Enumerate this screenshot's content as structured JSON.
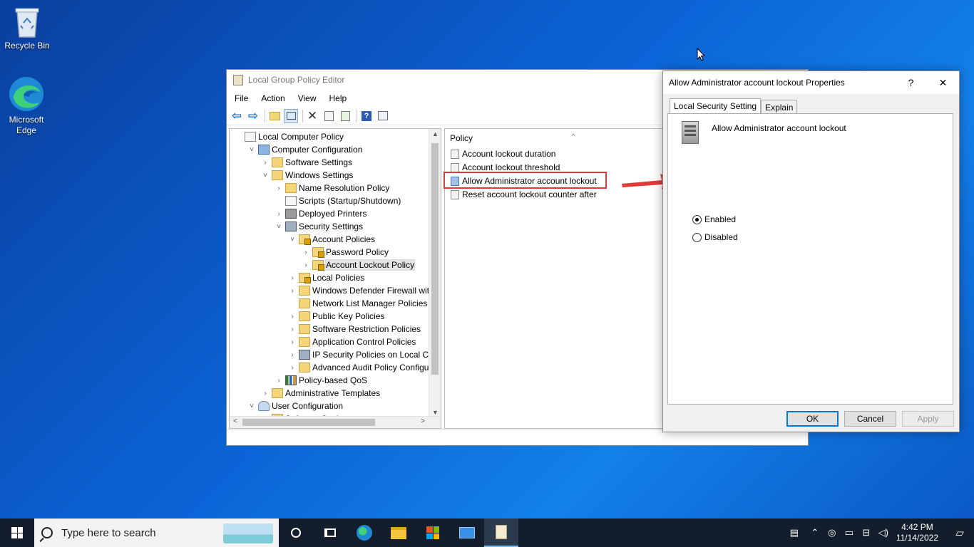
{
  "desktop": {
    "icons": [
      {
        "label": "Recycle Bin"
      },
      {
        "label": "Microsoft Edge"
      }
    ]
  },
  "gpo": {
    "title": "Local Group Policy Editor",
    "menu": [
      "File",
      "Action",
      "View",
      "Help"
    ],
    "tree": [
      {
        "label": "Local Computer Policy",
        "icon": "document-icon",
        "expander": ""
      },
      {
        "label": "Computer Configuration",
        "icon": "computer-icon",
        "expander": "˅"
      },
      {
        "label": "Software Settings",
        "icon": "folder-icon",
        "expander": "›"
      },
      {
        "label": "Windows Settings",
        "icon": "folder-icon",
        "expander": "˅"
      },
      {
        "label": "Name Resolution Policy",
        "icon": "folder-icon",
        "expander": "›"
      },
      {
        "label": "Scripts (Startup/Shutdown)",
        "icon": "script-icon",
        "expander": ""
      },
      {
        "label": "Deployed Printers",
        "icon": "printer-icon",
        "expander": "›"
      },
      {
        "label": "Security Settings",
        "icon": "security-icon",
        "expander": "˅"
      },
      {
        "label": "Account Policies",
        "icon": "folder-lock-icon",
        "expander": "˅"
      },
      {
        "label": "Password Policy",
        "icon": "folder-lock-icon",
        "expander": "›"
      },
      {
        "label": "Account Lockout Policy",
        "icon": "folder-lock-icon",
        "expander": "›",
        "selected": true
      },
      {
        "label": "Local Policies",
        "icon": "folder-lock-icon",
        "expander": "›"
      },
      {
        "label": "Windows Defender Firewall with A",
        "icon": "folder-icon",
        "expander": "›"
      },
      {
        "label": "Network List Manager Policies",
        "icon": "folder-icon",
        "expander": ""
      },
      {
        "label": "Public Key Policies",
        "icon": "folder-icon",
        "expander": "›"
      },
      {
        "label": "Software Restriction Policies",
        "icon": "folder-icon",
        "expander": "›"
      },
      {
        "label": "Application Control Policies",
        "icon": "folder-icon",
        "expander": "›"
      },
      {
        "label": "IP Security Policies on Local Comp",
        "icon": "ip-security-icon",
        "expander": "›"
      },
      {
        "label": "Advanced Audit Policy Configurat",
        "icon": "folder-icon",
        "expander": "›"
      },
      {
        "label": "Policy-based QoS",
        "icon": "chart-icon",
        "expander": "›"
      },
      {
        "label": "Administrative Templates",
        "icon": "folder-icon",
        "expander": "›"
      },
      {
        "label": "User Configuration",
        "icon": "user-icon",
        "expander": "˅"
      },
      {
        "label": "Software Settings",
        "icon": "folder-icon",
        "expander": "›"
      }
    ],
    "policy_header": "Policy",
    "policies": [
      {
        "label": "Account lockout duration"
      },
      {
        "label": "Account lockout threshold"
      },
      {
        "label": "Allow Administrator account lockout",
        "selected": true
      },
      {
        "label": "Reset account lockout counter after"
      }
    ]
  },
  "dialog": {
    "title": "Allow Administrator account lockout Properties",
    "help": "?",
    "close": "✕",
    "tabs": [
      "Local Security Setting",
      "Explain"
    ],
    "setting_name": "Allow Administrator account lockout",
    "options": [
      {
        "label": "Enabled",
        "checked": true
      },
      {
        "label": "Disabled",
        "checked": false
      }
    ],
    "buttons": {
      "ok": "OK",
      "cancel": "Cancel",
      "apply": "Apply"
    }
  },
  "taskbar": {
    "search_placeholder": "Type here to search",
    "time": "4:42 PM",
    "date": "11/14/2022"
  },
  "colors": {
    "highlight": "#e03a3a",
    "accent": "#0078d7"
  }
}
